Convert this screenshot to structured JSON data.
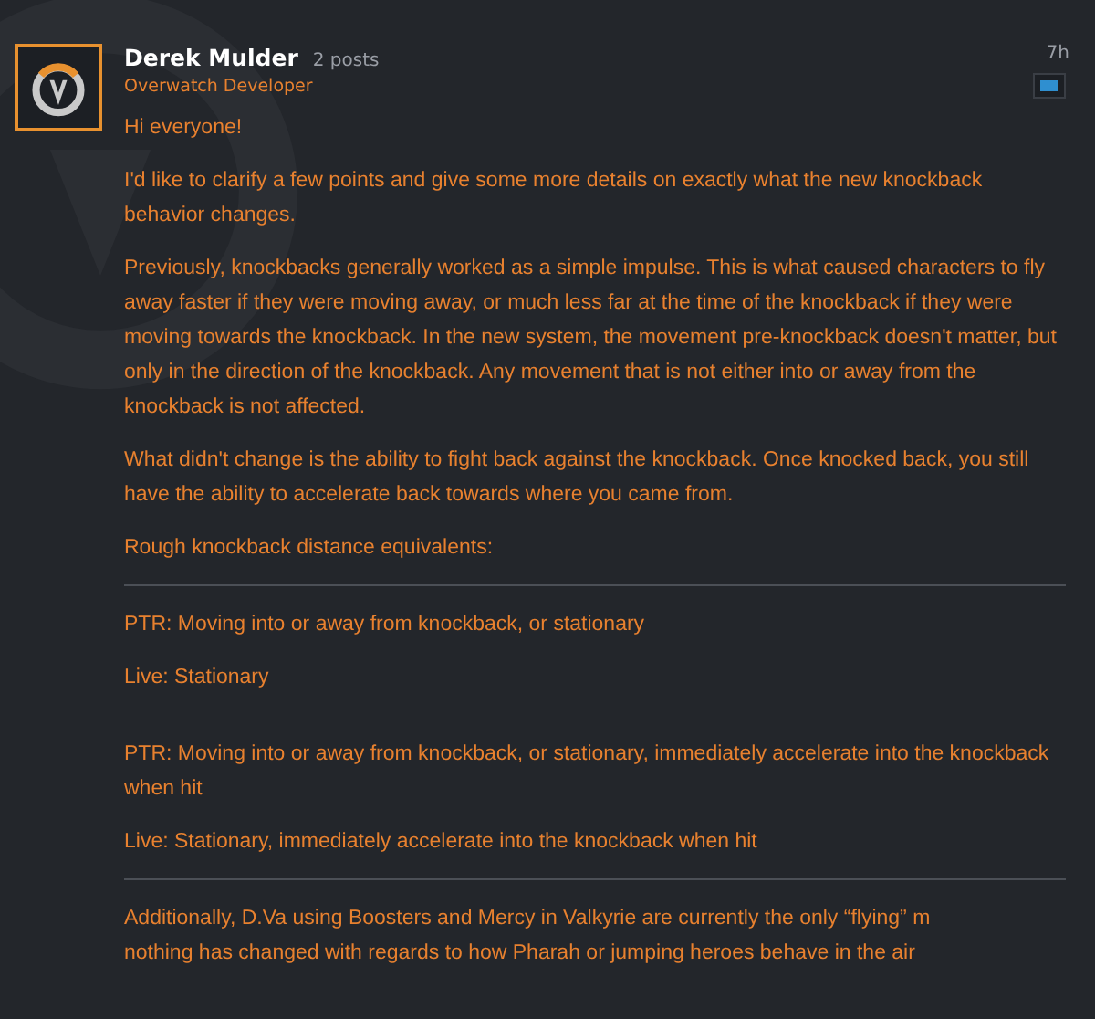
{
  "post": {
    "author": "Derek Mulder",
    "post_count": "2 posts",
    "role": "Overwatch Developer",
    "time": "7h",
    "blocks": [
      {
        "kind": "para",
        "text": "Hi everyone!"
      },
      {
        "kind": "para",
        "text": "I'd like to clarify a few points and give some more details on exactly what the new knockback behavior changes."
      },
      {
        "kind": "para",
        "text": "Previously, knockbacks generally worked as a simple impulse. This is what caused characters to fly away faster if they were moving away, or much less far at the time of the knockback if they were moving towards the knockback. In the new system, the movement pre-knockback doesn't matter, but only in the direction of the knockback. Any movement that is not either into or away from the knockback is not affected."
      },
      {
        "kind": "para",
        "text": "What didn't change is the ability to fight back against the knockback. Once knocked back, you still have the ability to accelerate back towards where you came from."
      },
      {
        "kind": "para",
        "text": "Rough knockback distance equivalents:"
      },
      {
        "kind": "rule"
      },
      {
        "kind": "para",
        "text": "PTR: Moving into or away from knockback, or stationary"
      },
      {
        "kind": "para",
        "text": "Live: Stationary"
      },
      {
        "kind": "gap"
      },
      {
        "kind": "para",
        "text": "PTR: Moving into or away from knockback, or stationary, immediately accelerate into the knockback when hit"
      },
      {
        "kind": "para",
        "text": "Live: Stationary, immediately accelerate into the knockback when hit"
      },
      {
        "kind": "rule"
      },
      {
        "kind": "line",
        "text": "Additionally, D.Va using Boosters and Mercy in Valkyrie are currently the only “flying” m"
      },
      {
        "kind": "line",
        "text": "nothing has changed with regards to how Pharah or jumping heroes behave in the air"
      }
    ]
  }
}
